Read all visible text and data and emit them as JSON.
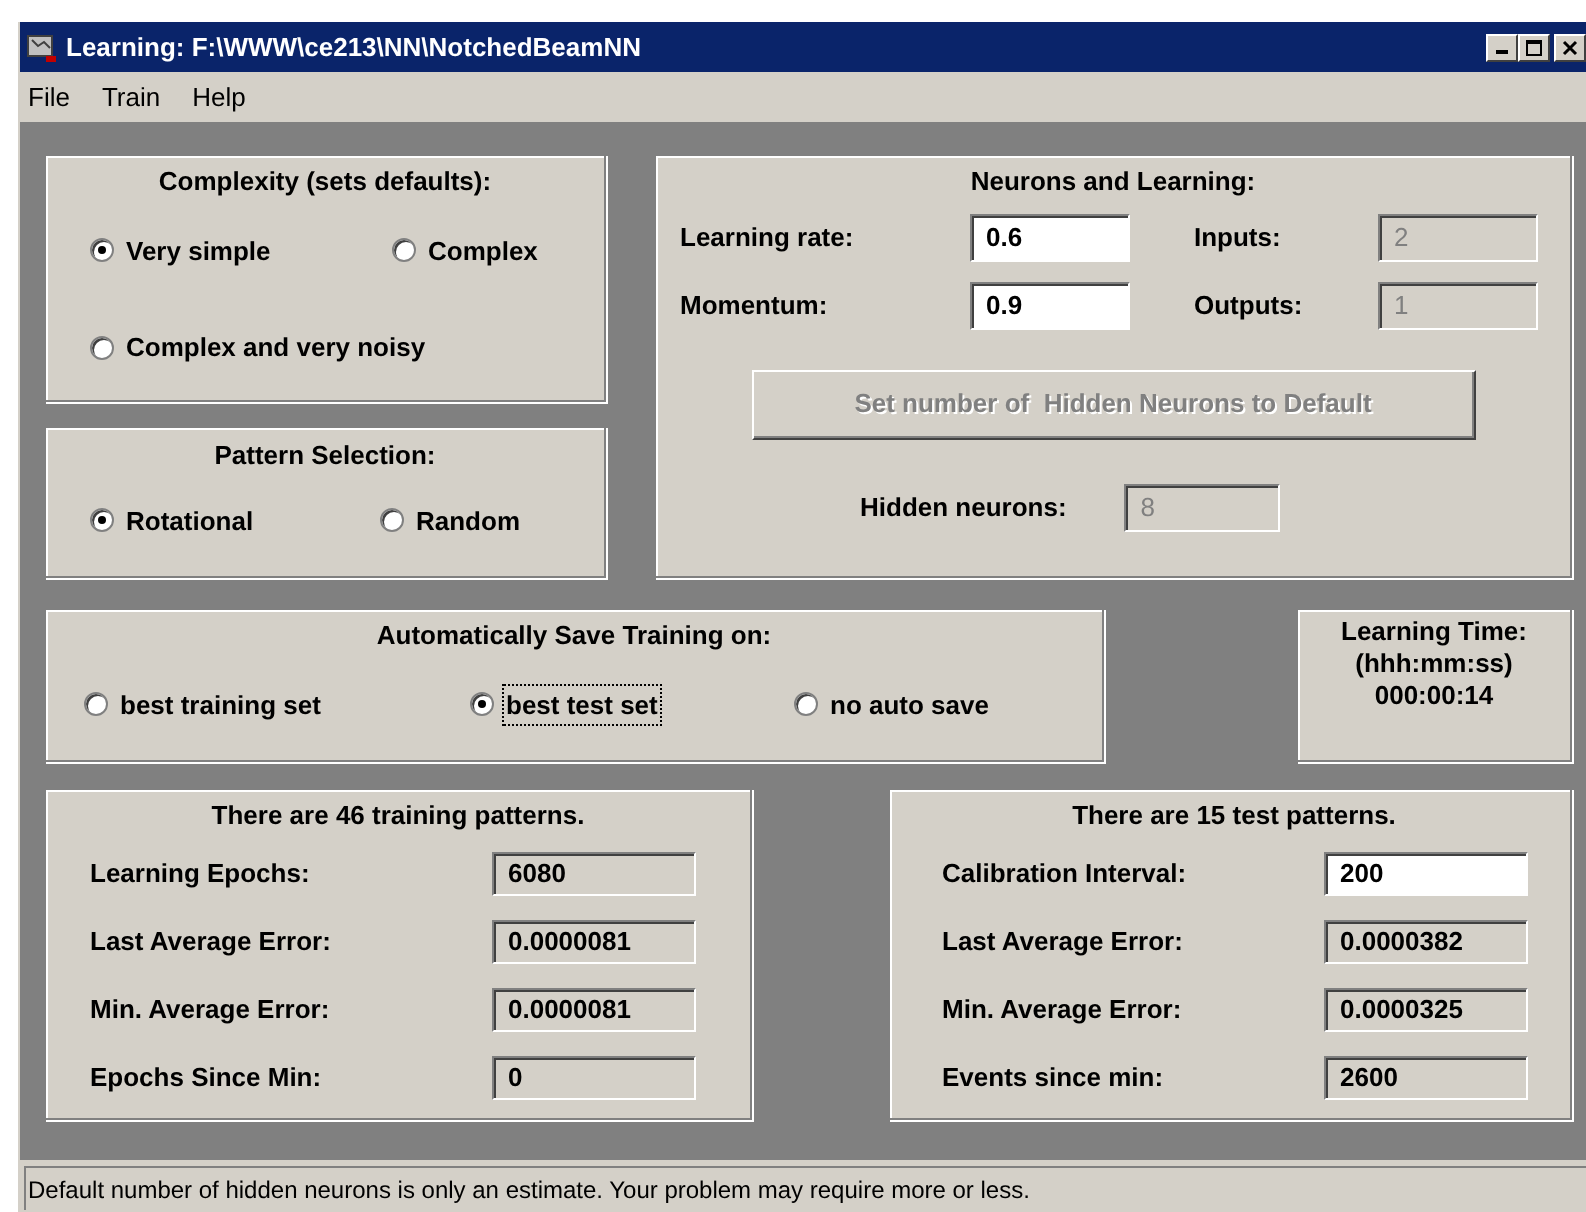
{
  "window": {
    "title": "Learning: F:\\WWW\\ce213\\NN\\NotchedBeamNN"
  },
  "menu": [
    {
      "label": "File"
    },
    {
      "label": "Train"
    },
    {
      "label": "Help"
    }
  ],
  "complexity": {
    "title": "Complexity (sets defaults):",
    "options": [
      {
        "label": "Very simple",
        "selected": true
      },
      {
        "label": "Complex",
        "selected": false
      },
      {
        "label": "Complex and very noisy",
        "selected": false
      }
    ]
  },
  "pattern_selection": {
    "title": "Pattern Selection:",
    "options": [
      {
        "label": "Rotational",
        "selected": true
      },
      {
        "label": "Random",
        "selected": false
      }
    ]
  },
  "neurons": {
    "title": "Neurons and Learning:",
    "fields": [
      {
        "label": "Learning rate:",
        "value": "0.6",
        "disabled": false
      },
      {
        "label": "Inputs:",
        "value": "2",
        "disabled": true
      },
      {
        "label": "Momentum:",
        "value": "0.9",
        "disabled": false
      },
      {
        "label": "Outputs:",
        "value": "1",
        "disabled": true
      }
    ],
    "button": {
      "label": "Set number of  Hidden Neurons to Default",
      "disabled": true
    },
    "hidden_neurons": {
      "label": "Hidden neurons:",
      "value": "8",
      "disabled": true
    }
  },
  "auto_save": {
    "title": "Automatically Save Training on:",
    "options": [
      {
        "label": "best training set",
        "selected": false,
        "focused": false
      },
      {
        "label": "best test set",
        "selected": true,
        "focused": true
      },
      {
        "label": "no auto save",
        "selected": false,
        "focused": false
      }
    ]
  },
  "learning_time": {
    "title": "Learning Time:",
    "format": "(hhh:mm:ss)",
    "value": "000:00:14"
  },
  "training": {
    "title": "There are 46 training patterns.",
    "rows": [
      {
        "label": "Learning Epochs:",
        "value": "6080",
        "editable": false
      },
      {
        "label": "Last Average Error:",
        "value": "0.0000081",
        "editable": false
      },
      {
        "label": "Min. Average Error:",
        "value": "0.0000081",
        "editable": false
      },
      {
        "label": "Epochs Since Min:",
        "value": "0",
        "editable": false
      }
    ]
  },
  "test": {
    "title": "There are 15 test patterns.",
    "rows": [
      {
        "label": "Calibration Interval:",
        "value": "200",
        "editable": true
      },
      {
        "label": "Last Average Error:",
        "value": "0.0000382",
        "editable": false
      },
      {
        "label": "Min. Average Error:",
        "value": "0.0000325",
        "editable": false
      },
      {
        "label": "Events since min:",
        "value": "2600",
        "editable": false
      }
    ]
  },
  "status_bar": {
    "text": "Default number of hidden neurons is only an estimate. Your problem may require more or less."
  }
}
